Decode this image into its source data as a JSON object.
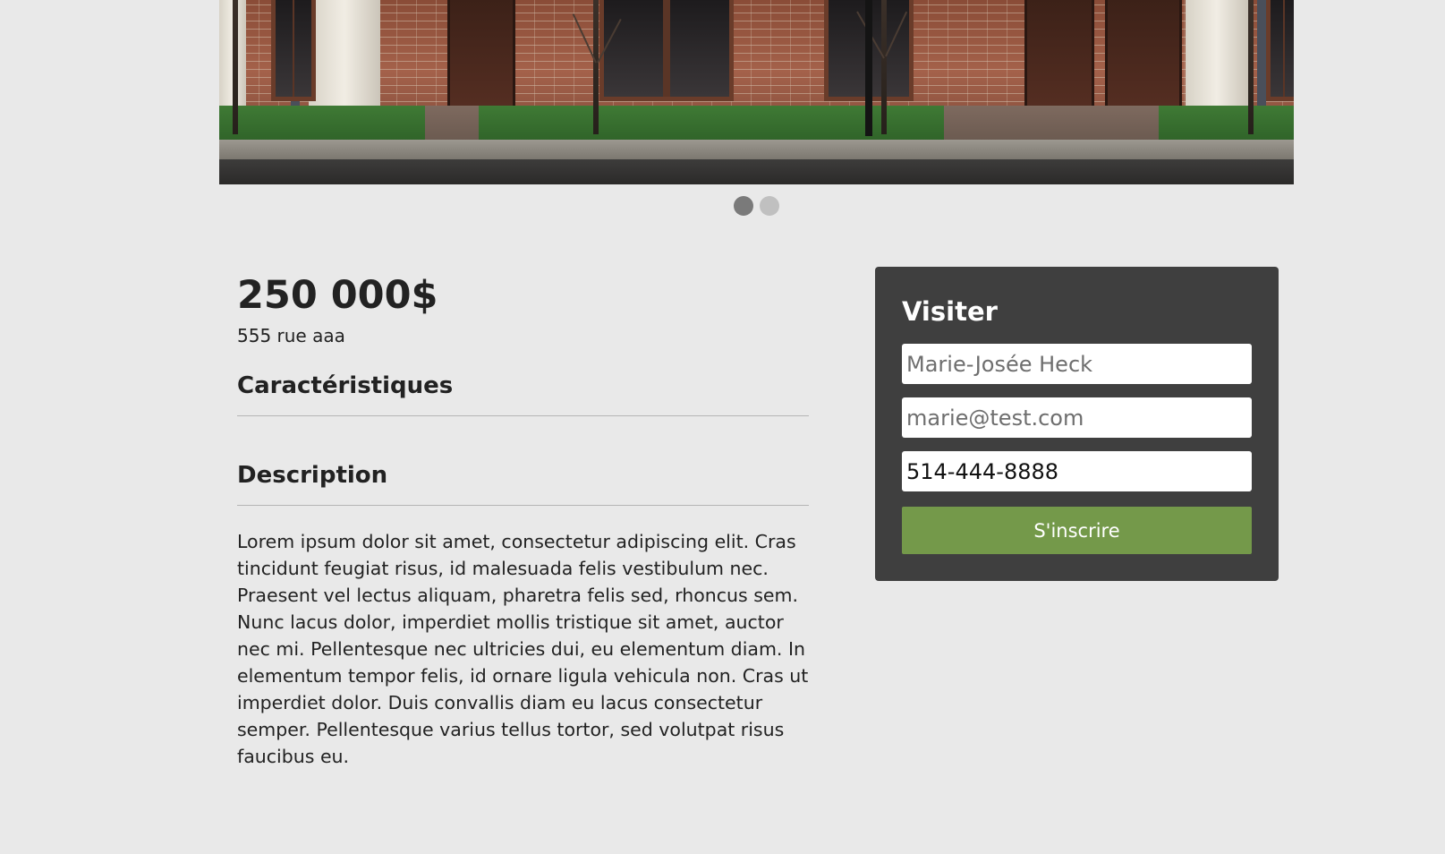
{
  "listing": {
    "price": "250 000$",
    "address": "555 rue aaa"
  },
  "carousel": {
    "slides": 2,
    "active_index": 0
  },
  "sections": {
    "features_title": "Caractéristiques",
    "description_title": "Description",
    "description_text": "Lorem ipsum dolor sit amet, consectetur adipiscing elit. Cras tincidunt feugiat risus, id malesuada felis vestibulum nec. Praesent vel lectus aliquam, pharetra felis sed, rhoncus sem. Nunc lacus dolor, imperdiet mollis tristique sit amet, auctor nec mi. Pellentesque nec ultricies dui, eu elementum diam. In elementum tempor felis, id ornare ligula vehicula non. Cras ut imperdiet dolor. Duis convallis diam eu lacus consectetur semper. Pellentesque varius tellus tortor, sed volutpat risus faucibus eu."
  },
  "visit_form": {
    "title": "Visiter",
    "name_placeholder": "Marie-Josée Heck",
    "email_placeholder": "marie@test.com",
    "phone_value": "514-444-8888",
    "submit_label": "S'inscrire"
  },
  "colors": {
    "background": "#e9e9e9",
    "panel": "#3f3f3f",
    "submit_button": "#74994a",
    "dot_active": "#7a7a7a",
    "dot_inactive": "#c0c0c0"
  }
}
